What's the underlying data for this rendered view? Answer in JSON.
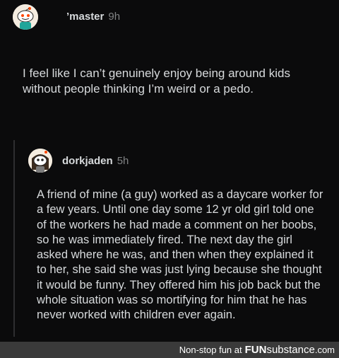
{
  "post": {
    "username": "’master",
    "time": "9h",
    "text": "I feel like I can’t genuinely enjoy being around kids without people thinking I’m weird or a pedo."
  },
  "reply": {
    "username": "dorkjaden",
    "time": "5h",
    "text": "A friend of mine (a guy) worked as a daycare worker for a few years. Until one day some 12 yr old girl told one of the workers he had made a comment on her boobs, so he was immediately fired. The next day the girl asked where he was, and then when they explained it to her, she said she was just lying because she thought it would be funny. They offered him his job back but the whole situation was so mortifying for him that he has never worked with children ever again."
  },
  "footer": {
    "prefix": "Non-stop fun at",
    "brand_bold": "FUN",
    "brand_rest": "substance",
    "brand_tld": ".com"
  },
  "icons": {
    "avatar_post": "reddit-snoo-avatar-icon",
    "avatar_reply": "reddit-snoo-avatar-icon"
  },
  "colors": {
    "background": "#0b0b0c",
    "text": "#d7dadc",
    "muted": "#818384",
    "footer_bg": "#3a3a3a"
  }
}
